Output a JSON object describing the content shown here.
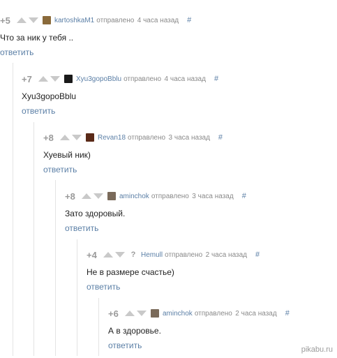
{
  "sent_label": "отправлено",
  "reply_label": "ответить",
  "hash_symbol": "#",
  "watermark": "pikabu.ru",
  "comments": [
    {
      "rating": "+5",
      "author": "kartoshkaM1",
      "time": "4 часа назад",
      "text": "Что за ник у тебя ..",
      "avatar_color": "#8a6a3a",
      "avatar_icon": "fist-avatar"
    },
    {
      "rating": "+7",
      "author": "Xyu3gopoBblu",
      "time": "4 часа назад",
      "text": "Xyu3gopoBblu",
      "avatar_color": "#1a1a1a",
      "avatar_icon": "dark-avatar"
    },
    {
      "rating": "+8",
      "author": "Revan18",
      "time": "3 часа назад",
      "text": "Хуевый ник)",
      "avatar_color": "#5a2a18",
      "avatar_icon": "revan-avatar"
    },
    {
      "rating": "+8",
      "author": "aminchok",
      "time": "3 часа назад",
      "text": "Зато здоровый.",
      "avatar_color": "#7a6a5a",
      "avatar_icon": "photo-avatar"
    },
    {
      "rating": "+4",
      "author": "Hemull",
      "time": "2 часа назад",
      "text": "Не в размере счастье)",
      "avatar_color": "",
      "avatar_icon": "question-mark-icon",
      "avatar_glyph": "?"
    },
    {
      "rating": "+6",
      "author": "aminchok",
      "time": "2 часа назад",
      "text": "А в здоровье.",
      "avatar_color": "#7a6a5a",
      "avatar_icon": "photo-avatar"
    }
  ]
}
